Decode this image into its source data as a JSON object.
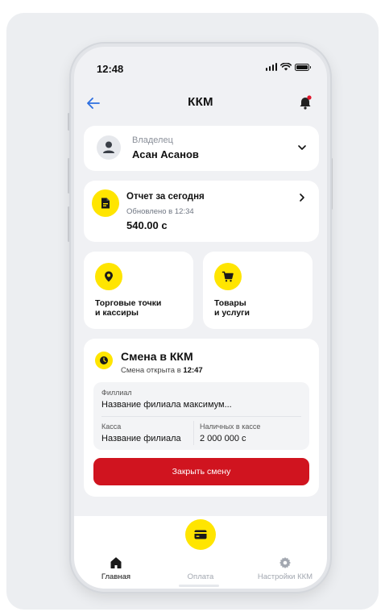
{
  "status_bar": {
    "time": "12:48"
  },
  "header": {
    "title": "ККМ"
  },
  "owner": {
    "label": "Владелец",
    "name": "Асан Асанов"
  },
  "report": {
    "title": "Отчет за сегодня",
    "updated": "Обновлено в  12:34",
    "amount": "540.00 с"
  },
  "tiles": [
    {
      "label": "Торговые точки\nи кассиры",
      "icon": "location-pin-icon"
    },
    {
      "label": "Товары\nи услуги",
      "icon": "shopping-cart-icon"
    }
  ],
  "shift": {
    "title": "Смена в ККМ",
    "subtitle_prefix": "Смена открыта в ",
    "opened_at": "12:47",
    "branch_label": "Филлиал",
    "branch_value": "Название филиала максимум...",
    "kassa_label": "Касса",
    "kassa_value": "Название филиала",
    "cash_label": "Наличных в кассе",
    "cash_value": "2 000 000 с",
    "close_button": "Закрыть смену"
  },
  "tabbar": {
    "home": "Главная",
    "pay": "Оплата",
    "settings": "Настройки ККМ"
  },
  "colors": {
    "accent_yellow": "#ffe500",
    "danger_red": "#d0141f",
    "back_arrow_blue": "#2d6fe0",
    "notification_dot": "#e0162b"
  }
}
